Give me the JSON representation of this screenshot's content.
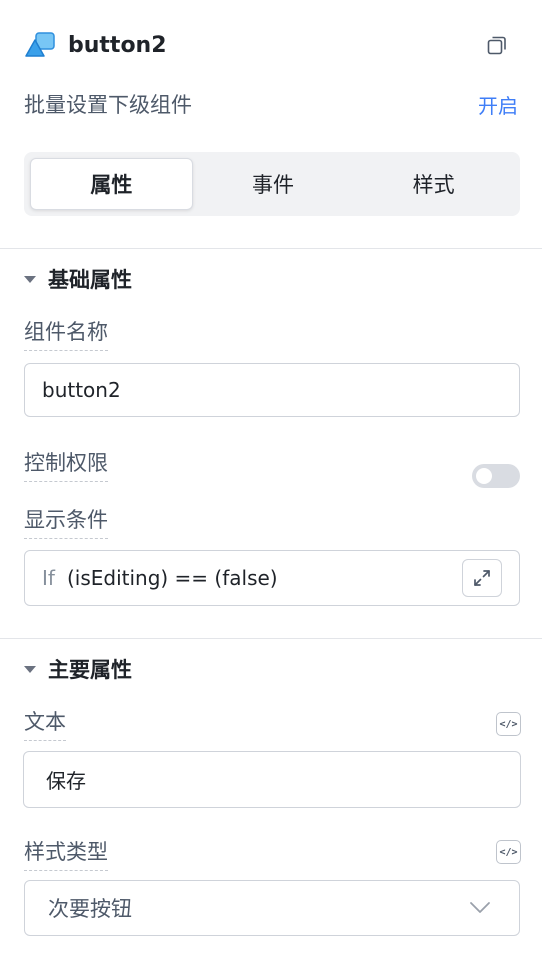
{
  "header": {
    "title": "button2",
    "icon": "component-icon",
    "copy_icon": "copy-icon"
  },
  "batch": {
    "label": "批量设置下级组件",
    "action": "开启"
  },
  "tabs": [
    {
      "label": "属性",
      "active": true
    },
    {
      "label": "事件",
      "active": false
    },
    {
      "label": "样式",
      "active": false
    }
  ],
  "basic": {
    "section_title": "基础属性",
    "name_label": "组件名称",
    "name_value": "button2",
    "permission_label": "控制权限",
    "permission_enabled": false,
    "condition_label": "显示条件",
    "condition_if": "If",
    "condition_expr": "(isEditing) == (false)"
  },
  "main": {
    "section_title": "主要属性",
    "text_label": "文本",
    "text_value": "保存",
    "style_label": "样式类型",
    "style_value": "次要按钮",
    "code_icon": "</>"
  },
  "colors": {
    "accent": "#3f7ef7",
    "icon_blue": "#4aa8ee"
  }
}
